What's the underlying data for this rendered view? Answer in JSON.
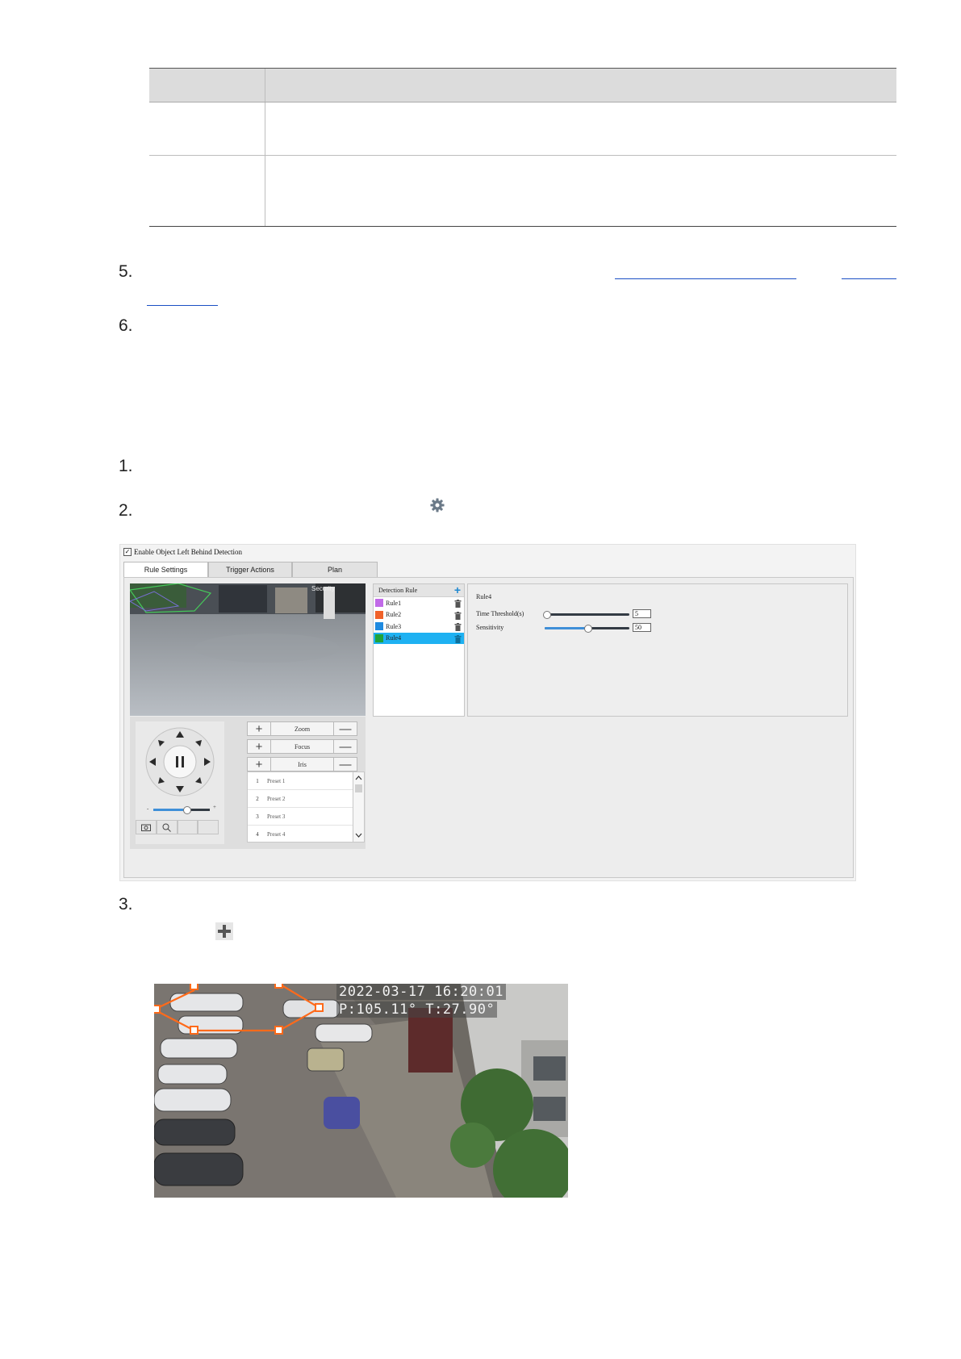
{
  "steps": [
    "5.",
    "6.",
    "1.",
    "2.",
    "3."
  ],
  "screenshot": {
    "enable_label": "Enable Object Left Behind Detection",
    "tabs": [
      "Rule Settings",
      "Trigger Actions",
      "Plan"
    ],
    "video_osd": "Security",
    "ptz_controls": {
      "zoom": "Zoom",
      "focus": "Focus",
      "iris": "Iris",
      "plus": "+",
      "minus": "—",
      "slider_min": "-",
      "slider_max": "+"
    },
    "presets": [
      {
        "num": "1",
        "name": "Preset 1"
      },
      {
        "num": "2",
        "name": "Preset 2"
      },
      {
        "num": "3",
        "name": "Preset 3"
      },
      {
        "num": "4",
        "name": "Preset 4"
      }
    ],
    "detection_rule_header": "Detection Rule",
    "rules": [
      {
        "name": "Rule1",
        "color": "#c16ae8",
        "selected": false
      },
      {
        "name": "Rule2",
        "color": "#f0622a",
        "selected": false
      },
      {
        "name": "Rule3",
        "color": "#1e8ae0",
        "selected": false
      },
      {
        "name": "Rule4",
        "color": "#1fa33a",
        "selected": true
      }
    ],
    "rule_detail": {
      "title": "Rule4",
      "time_threshold_label": "Time Threshold(s)",
      "time_threshold_value": "5",
      "time_threshold_level": 0.02,
      "sensitivity_label": "Sensitivity",
      "sensitivity_value": "50",
      "sensitivity_level": 0.5
    }
  },
  "photo": {
    "osd_datetime": "2022-03-17  16:20:01",
    "osd_position": "P:105.11°   T:27.90°"
  }
}
